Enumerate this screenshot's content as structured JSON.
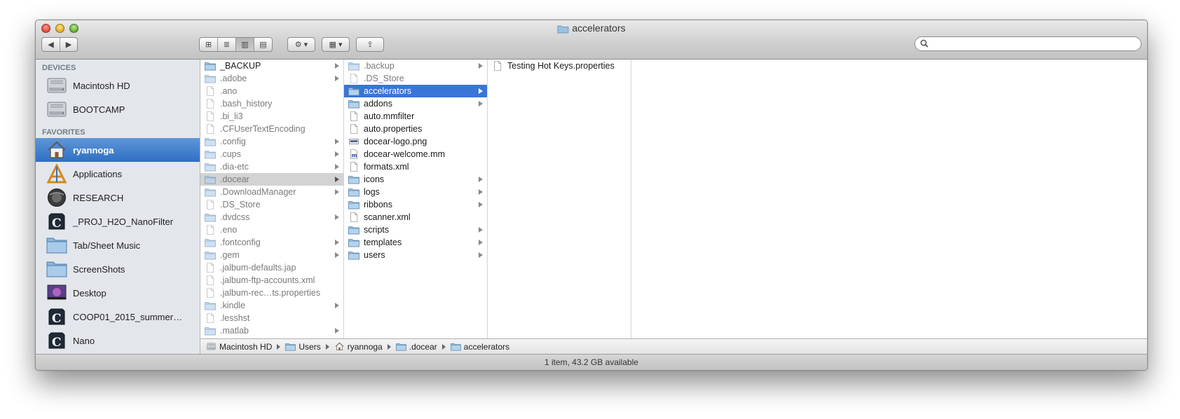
{
  "window": {
    "title": "accelerators"
  },
  "toolbar": {
    "back_label": "◀",
    "forward_label": "▶",
    "view_icons_label": "⊞",
    "view_list_label": "≣",
    "view_columns_label": "▥",
    "view_coverflow_label": "▤",
    "action_label": "⚙ ▾",
    "arrange_label": "▦ ▾",
    "share_label": "⇪",
    "search_placeholder": ""
  },
  "sidebar": {
    "sections": [
      {
        "title": "DEVICES",
        "items": [
          {
            "label": "Macintosh HD",
            "icon": "hard-drive-icon"
          },
          {
            "label": "BOOTCAMP",
            "icon": "hard-drive-icon"
          }
        ]
      },
      {
        "title": "FAVORITES",
        "items": [
          {
            "label": "ryannoga",
            "icon": "home-icon",
            "selected": true
          },
          {
            "label": "Applications",
            "icon": "applications-icon"
          },
          {
            "label": "RESEARCH",
            "icon": "drive-image-icon"
          },
          {
            "label": "_PROJ_H2O_NanoFilter",
            "icon": "uc-logo-icon"
          },
          {
            "label": "Tab/Sheet Music",
            "icon": "folder-icon"
          },
          {
            "label": "ScreenShots",
            "icon": "folder-icon"
          },
          {
            "label": "Desktop",
            "icon": "desktop-icon"
          },
          {
            "label": "COOP01_2015_summer…",
            "icon": "uc-logo-icon"
          },
          {
            "label": "Nano",
            "icon": "uc-logo-icon"
          }
        ]
      }
    ]
  },
  "columns": [
    {
      "items": [
        {
          "name": "_BACKUP",
          "kind": "folder",
          "arrow": true,
          "hidden": false
        },
        {
          "name": ".adobe",
          "kind": "folder",
          "arrow": true,
          "hidden": true
        },
        {
          "name": ".ano",
          "kind": "file",
          "arrow": false,
          "hidden": true
        },
        {
          "name": ".bash_history",
          "kind": "file",
          "arrow": false,
          "hidden": true
        },
        {
          "name": ".bi_li3",
          "kind": "file",
          "arrow": false,
          "hidden": true
        },
        {
          "name": ".CFUserTextEncoding",
          "kind": "file",
          "arrow": false,
          "hidden": true
        },
        {
          "name": ".config",
          "kind": "folder",
          "arrow": true,
          "hidden": true
        },
        {
          "name": ".cups",
          "kind": "folder",
          "arrow": true,
          "hidden": true
        },
        {
          "name": ".dia-etc",
          "kind": "folder",
          "arrow": true,
          "hidden": true
        },
        {
          "name": ".docear",
          "kind": "folder",
          "arrow": true,
          "hidden": true,
          "state": "path"
        },
        {
          "name": ".DownloadManager",
          "kind": "folder",
          "arrow": true,
          "hidden": true
        },
        {
          "name": ".DS_Store",
          "kind": "file",
          "arrow": false,
          "hidden": true
        },
        {
          "name": ".dvdcss",
          "kind": "folder",
          "arrow": true,
          "hidden": true
        },
        {
          "name": ".eno",
          "kind": "file",
          "arrow": false,
          "hidden": true
        },
        {
          "name": ".fontconfig",
          "kind": "folder",
          "arrow": true,
          "hidden": true
        },
        {
          "name": ".gem",
          "kind": "folder",
          "arrow": true,
          "hidden": true
        },
        {
          "name": ".jalbum-defaults.jap",
          "kind": "file",
          "arrow": false,
          "hidden": true
        },
        {
          "name": ".jalbum-ftp-accounts.xml",
          "kind": "file",
          "arrow": false,
          "hidden": true
        },
        {
          "name": ".jalbum-rec…ts.properties",
          "kind": "file",
          "arrow": false,
          "hidden": true
        },
        {
          "name": ".kindle",
          "kind": "folder",
          "arrow": true,
          "hidden": true
        },
        {
          "name": ".lesshst",
          "kind": "file",
          "arrow": false,
          "hidden": true
        },
        {
          "name": ".matlab",
          "kind": "folder",
          "arrow": true,
          "hidden": true
        }
      ]
    },
    {
      "items": [
        {
          "name": ".backup",
          "kind": "folder",
          "arrow": true,
          "hidden": true
        },
        {
          "name": ".DS_Store",
          "kind": "file",
          "arrow": false,
          "hidden": true
        },
        {
          "name": "accelerators",
          "kind": "folder",
          "arrow": true,
          "hidden": false,
          "state": "selected"
        },
        {
          "name": "addons",
          "kind": "folder",
          "arrow": true,
          "hidden": false
        },
        {
          "name": "auto.mmfilter",
          "kind": "file",
          "arrow": false,
          "hidden": false
        },
        {
          "name": "auto.properties",
          "kind": "file",
          "arrow": false,
          "hidden": false
        },
        {
          "name": "docear-logo.png",
          "kind": "image",
          "arrow": false,
          "hidden": false
        },
        {
          "name": "docear-welcome.mm",
          "kind": "mindmap",
          "arrow": false,
          "hidden": false
        },
        {
          "name": "formats.xml",
          "kind": "file",
          "arrow": false,
          "hidden": false
        },
        {
          "name": "icons",
          "kind": "folder",
          "arrow": true,
          "hidden": false
        },
        {
          "name": "logs",
          "kind": "folder",
          "arrow": true,
          "hidden": false
        },
        {
          "name": "ribbons",
          "kind": "folder",
          "arrow": true,
          "hidden": false
        },
        {
          "name": "scanner.xml",
          "kind": "file",
          "arrow": false,
          "hidden": false
        },
        {
          "name": "scripts",
          "kind": "folder",
          "arrow": true,
          "hidden": false
        },
        {
          "name": "templates",
          "kind": "folder",
          "arrow": true,
          "hidden": false
        },
        {
          "name": "users",
          "kind": "folder",
          "arrow": true,
          "hidden": false
        }
      ]
    },
    {
      "items": [
        {
          "name": "Testing Hot Keys.properties",
          "kind": "file",
          "arrow": false,
          "hidden": false
        }
      ]
    }
  ],
  "pathbar": [
    {
      "label": "Macintosh HD",
      "icon": "hard-drive-icon"
    },
    {
      "label": "Users",
      "icon": "folder-icon"
    },
    {
      "label": "ryannoga",
      "icon": "home-icon"
    },
    {
      "label": ".docear",
      "icon": "folder-icon"
    },
    {
      "label": "accelerators",
      "icon": "folder-icon"
    }
  ],
  "status": {
    "text": "1 item, 43.2 GB available"
  },
  "colors": {
    "accent": "#3875d7",
    "sidebar_bg": "#e3e7ec",
    "folder": "#8fb8dc"
  }
}
